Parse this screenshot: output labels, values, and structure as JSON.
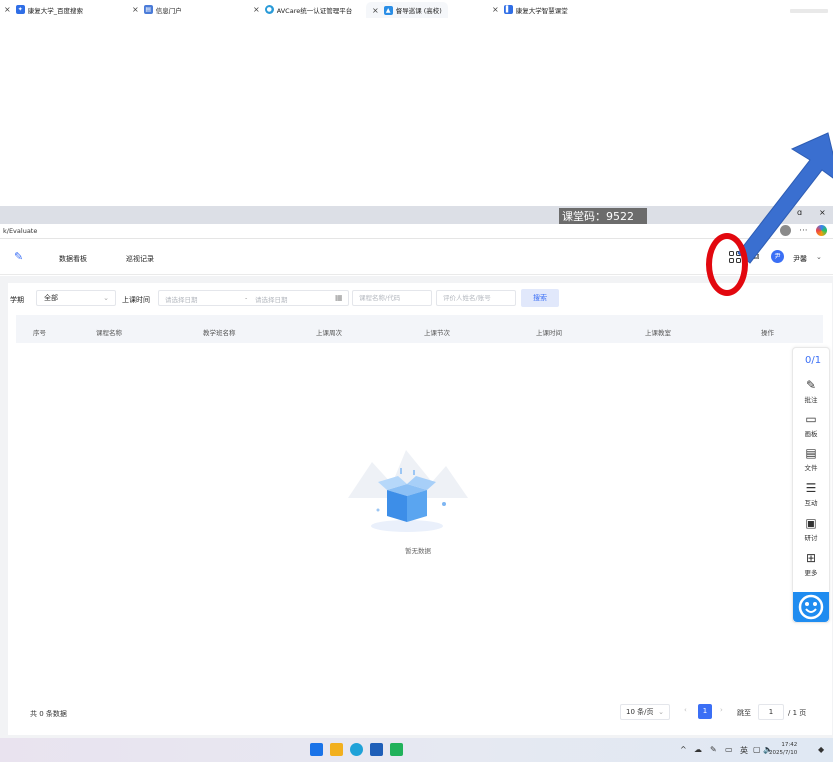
{
  "browser": {
    "tabs": [
      {
        "label": "康复大学_百度搜索",
        "icon": "baidu-icon",
        "color": "#2f6ee6"
      },
      {
        "label": "信息门户",
        "icon": "portal-icon",
        "color": "#4a7bd8"
      },
      {
        "label": "AVCare统一认证管理平台",
        "icon": "avcare-icon",
        "color": "#2a9bd8"
      },
      {
        "label": "督导巡课 (高校)",
        "icon": "graduation-cap-icon",
        "color": "#2a8ee6"
      },
      {
        "label": "康复大学智慧课堂",
        "icon": "smart-class-icon",
        "color": "#2f6ee6"
      }
    ],
    "close_glyph": "×",
    "class_code": "课堂码：9522",
    "window_controls": {
      "restore": "ɑ",
      "close": "×"
    },
    "url": "k/Evaluate",
    "extras_glyph": "···"
  },
  "header": {
    "nav": [
      "数据看板",
      "巡视记录"
    ],
    "user_name": "尹馨",
    "user_avatar_text": "尹",
    "caret": "⌄"
  },
  "filters": {
    "term_label": "学期",
    "term_value": "全部",
    "time_label": "上课时间",
    "date_start_placeholder": "请选择日期",
    "date_sep": "-",
    "date_end_placeholder": "请选择日期",
    "course_placeholder": "课程名称/代码",
    "evaluator_placeholder": "评价人姓名/账号",
    "search_label": "搜索"
  },
  "table": {
    "columns": [
      "序号",
      "课程名称",
      "教学班名称",
      "上课周次",
      "上课节次",
      "上课时间",
      "上课教室",
      "操作"
    ],
    "rows": [],
    "empty_text": "暂无数据"
  },
  "rail": {
    "count": "0/1",
    "items": [
      {
        "label": "批注",
        "icon": "annotate-icon",
        "glyph": "✎"
      },
      {
        "label": "画板",
        "icon": "whiteboard-icon",
        "glyph": "▭"
      },
      {
        "label": "文件",
        "icon": "file-icon",
        "glyph": "▤"
      },
      {
        "label": "互动",
        "icon": "interact-icon",
        "glyph": "☰"
      },
      {
        "label": "研讨",
        "icon": "discuss-icon",
        "glyph": "▣"
      },
      {
        "label": "更多",
        "icon": "more-grid-icon",
        "glyph": "⊞"
      }
    ]
  },
  "pagination": {
    "total": "共 0 条数据",
    "page_size": "10 条/页",
    "prev": "‹",
    "current": "1",
    "next": "›",
    "jump_label": "跳至",
    "jump_value": "1",
    "total_pages": "/ 1 页"
  },
  "taskbar": {
    "apps": [
      {
        "icon": "windows-start-icon",
        "color": "#1a73e8"
      },
      {
        "icon": "file-explorer-icon",
        "color": "#f2b01e"
      },
      {
        "icon": "edge-browser-icon",
        "color": "#1fa2d8"
      },
      {
        "icon": "store-icon",
        "color": "#1f5fb8"
      },
      {
        "icon": "chat-app-icon",
        "color": "#21b25b"
      }
    ],
    "tray": [
      "^",
      "☁",
      "✎",
      "▭",
      "英",
      "▢",
      "🔈"
    ],
    "time": "17:42",
    "date": "2025/7/10"
  },
  "colors": {
    "accent": "#3b6ff5",
    "annotation_red": "#e2080f",
    "annotation_arrow": "#3a6fd0"
  }
}
